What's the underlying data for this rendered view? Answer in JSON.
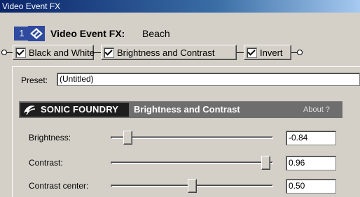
{
  "window": {
    "title": "Video Event FX"
  },
  "header": {
    "number": "1",
    "title": "Video Event FX:",
    "event_name": "Beach"
  },
  "chain": {
    "items": [
      {
        "label": "Black and White",
        "checked": true
      },
      {
        "label": "Brightness and Contrast",
        "checked": true
      },
      {
        "label": "Invert",
        "checked": true
      }
    ]
  },
  "preset": {
    "label": "Preset:",
    "value": "(Untitled)"
  },
  "plugin": {
    "brand": "SONIC FOUNDRY",
    "title": "Brightness and Contrast",
    "about": "About ?"
  },
  "params": [
    {
      "label": "Brightness:",
      "value": "-0.84",
      "level": 0.08
    },
    {
      "label": "Contrast:",
      "value": "0.96",
      "level": 0.98
    },
    {
      "label": "Contrast center:",
      "value": "0.50",
      "level": 0.5
    }
  ],
  "colors": {
    "titlebar": "#0a246a",
    "accent": "#2f4a9e",
    "plugin_bar": "#6e6e6e"
  }
}
